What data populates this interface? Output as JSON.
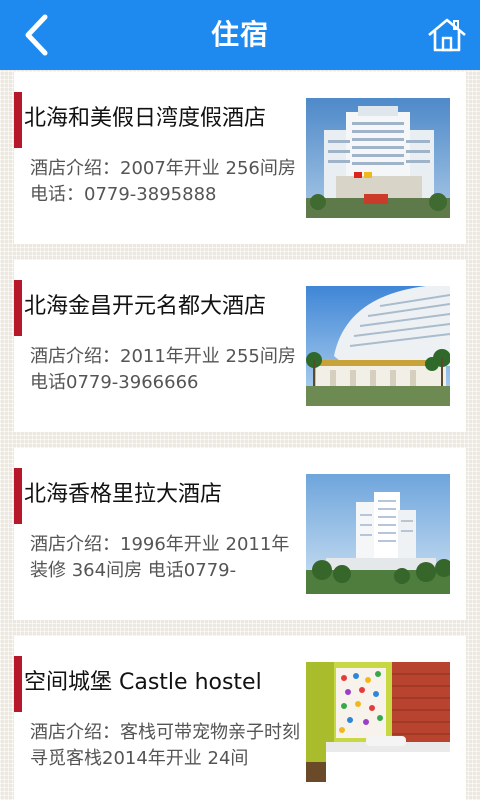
{
  "header": {
    "title": "住宿",
    "back_icon": "back-chevron-icon",
    "home_icon": "home-icon"
  },
  "colors": {
    "header_bg": "#1e8af0",
    "accent_bar": "#b7172b"
  },
  "hotels": [
    {
      "name": "北海和美假日湾度假酒店",
      "desc": "酒店介绍：2007年开业 256间房 电话：0779-3895888",
      "image": "hotel-tower-photo"
    },
    {
      "name": "北海金昌开元名都大酒店",
      "desc": "酒店介绍：2011年开业 255间房 电话0779-3966666",
      "image": "hotel-curved-tower-photo"
    },
    {
      "name": "北海香格里拉大酒店",
      "desc": "酒店介绍：1996年开业 2011年装修 364间房 电话0779-",
      "image": "hotel-white-tower-photo"
    },
    {
      "name": "空间城堡 Castle hostel",
      "desc": "酒店介绍：客栈可带宠物亲子时刻寻觅客栈2014年开业 24间",
      "image": "hostel-room-photo"
    }
  ]
}
